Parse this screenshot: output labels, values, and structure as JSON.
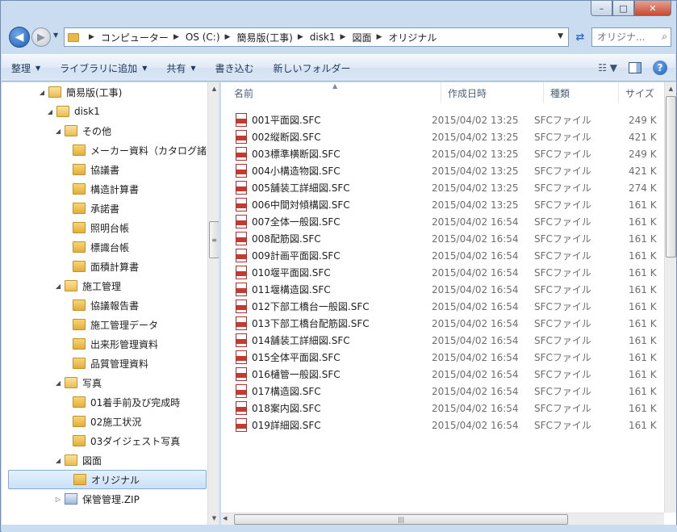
{
  "window": {
    "buttons": {
      "minimize": "–",
      "maximize": "□",
      "close": "✕"
    }
  },
  "address": {
    "crumbs": [
      "コンピューター",
      "OS (C:)",
      "簡易版(工事)",
      "disk1",
      "図面",
      "オリジナル"
    ],
    "search_placeholder": "オリジナ..."
  },
  "toolbar": {
    "organize": "整理",
    "add_to_library": "ライブラリに追加",
    "share": "共有",
    "burn": "書き込む",
    "new_folder": "新しいフォルダー"
  },
  "tree": {
    "items": [
      {
        "label": "簡易版(工事)",
        "type": "folder",
        "expanded": true
      },
      {
        "label": "disk1",
        "type": "folder",
        "expanded": true
      },
      {
        "label": "その他",
        "type": "folder",
        "expanded": true
      },
      {
        "label": "メーカー資料（カタログ諸",
        "type": "folder"
      },
      {
        "label": "協議書",
        "type": "folder"
      },
      {
        "label": "構造計算書",
        "type": "folder"
      },
      {
        "label": "承諾書",
        "type": "folder"
      },
      {
        "label": "照明台帳",
        "type": "folder"
      },
      {
        "label": "標識台帳",
        "type": "folder"
      },
      {
        "label": "面積計算書",
        "type": "folder"
      },
      {
        "label": "施工管理",
        "type": "folder",
        "expanded": true
      },
      {
        "label": "協議報告書",
        "type": "folder"
      },
      {
        "label": "施工管理データ",
        "type": "folder"
      },
      {
        "label": "出来形管理資料",
        "type": "folder"
      },
      {
        "label": "品質管理資料",
        "type": "folder"
      },
      {
        "label": "写真",
        "type": "folder",
        "expanded": true
      },
      {
        "label": "01着手前及び完成時",
        "type": "folder"
      },
      {
        "label": "02施工状況",
        "type": "folder"
      },
      {
        "label": "03ダイジェスト写真",
        "type": "folder"
      },
      {
        "label": "図面",
        "type": "folder",
        "expanded": true
      },
      {
        "label": "オリジナル",
        "type": "folder",
        "selected": true
      },
      {
        "label": "保管管理.ZIP",
        "type": "zip"
      }
    ]
  },
  "columns": {
    "name": "名前",
    "date": "作成日時",
    "type": "種類",
    "size": "サイズ"
  },
  "files": [
    {
      "name": "001平面図.SFC",
      "date": "2015/04/02 13:25",
      "type": "SFCファイル",
      "size": "249 K"
    },
    {
      "name": "002縦断図.SFC",
      "date": "2015/04/02 13:25",
      "type": "SFCファイル",
      "size": "421 K"
    },
    {
      "name": "003標準横断図.SFC",
      "date": "2015/04/02 13:25",
      "type": "SFCファイル",
      "size": "249 K"
    },
    {
      "name": "004小構造物図.SFC",
      "date": "2015/04/02 13:25",
      "type": "SFCファイル",
      "size": "421 K"
    },
    {
      "name": "005舗装工詳細図.SFC",
      "date": "2015/04/02 13:25",
      "type": "SFCファイル",
      "size": "274 K"
    },
    {
      "name": "006中間対傾構図.SFC",
      "date": "2015/04/02 13:25",
      "type": "SFCファイル",
      "size": "161 K"
    },
    {
      "name": "007全体一般図.SFC",
      "date": "2015/04/02 16:54",
      "type": "SFCファイル",
      "size": "161 K"
    },
    {
      "name": "008配筋図.SFC",
      "date": "2015/04/02 16:54",
      "type": "SFCファイル",
      "size": "161 K"
    },
    {
      "name": "009計画平面図.SFC",
      "date": "2015/04/02 16:54",
      "type": "SFCファイル",
      "size": "161 K"
    },
    {
      "name": "010堰平面図.SFC",
      "date": "2015/04/02 16:54",
      "type": "SFCファイル",
      "size": "161 K"
    },
    {
      "name": "011堰構造図.SFC",
      "date": "2015/04/02 16:54",
      "type": "SFCファイル",
      "size": "161 K"
    },
    {
      "name": "012下部工橋台一般図.SFC",
      "date": "2015/04/02 16:54",
      "type": "SFCファイル",
      "size": "161 K"
    },
    {
      "name": "013下部工橋台配筋図.SFC",
      "date": "2015/04/02 16:54",
      "type": "SFCファイル",
      "size": "161 K"
    },
    {
      "name": "014舗装工詳細図.SFC",
      "date": "2015/04/02 16:54",
      "type": "SFCファイル",
      "size": "161 K"
    },
    {
      "name": "015全体平面図.SFC",
      "date": "2015/04/02 16:54",
      "type": "SFCファイル",
      "size": "161 K"
    },
    {
      "name": "016樋管一般図.SFC",
      "date": "2015/04/02 16:54",
      "type": "SFCファイル",
      "size": "161 K"
    },
    {
      "name": "017構造図.SFC",
      "date": "2015/04/02 16:54",
      "type": "SFCファイル",
      "size": "161 K"
    },
    {
      "name": "018案内図.SFC",
      "date": "2015/04/02 16:54",
      "type": "SFCファイル",
      "size": "161 K"
    },
    {
      "name": "019詳細図.SFC",
      "date": "2015/04/02 16:54",
      "type": "SFCファイル",
      "size": "161 K"
    }
  ]
}
